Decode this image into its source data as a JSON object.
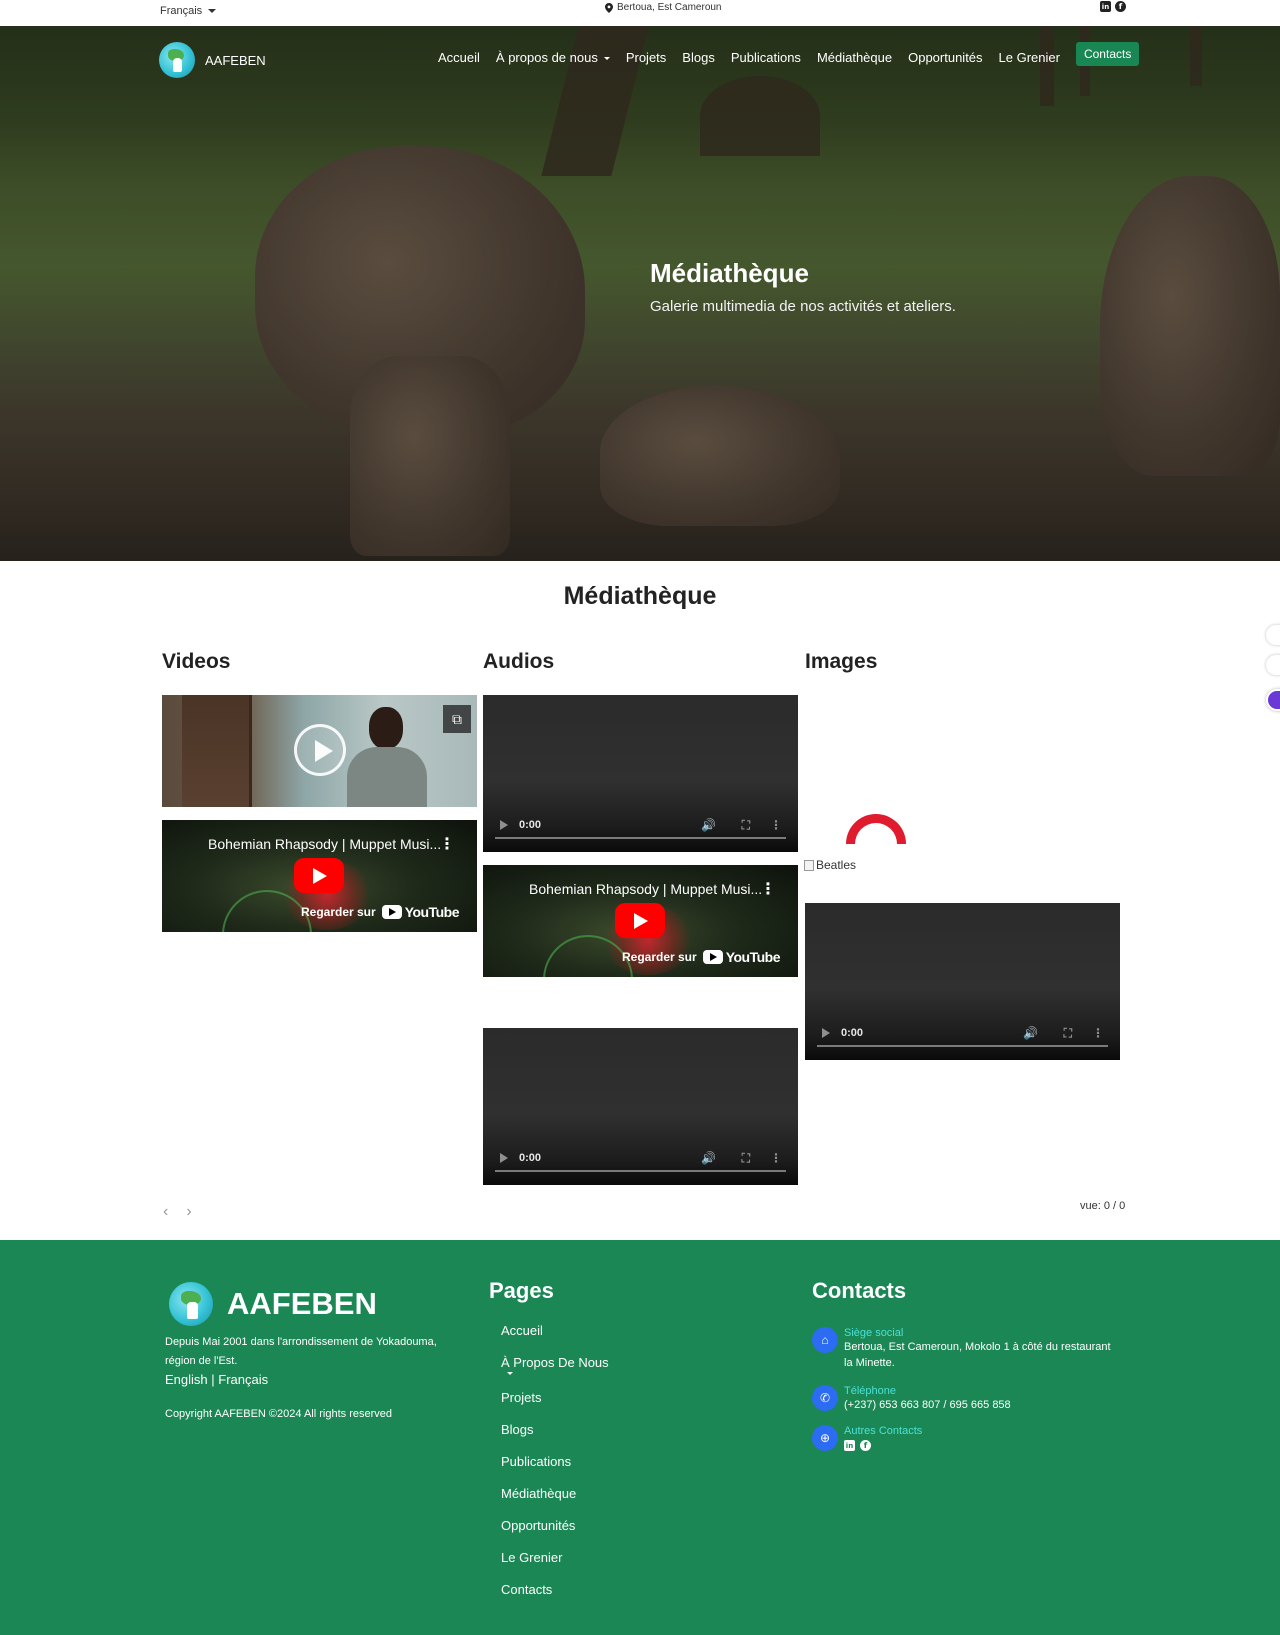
{
  "topbar": {
    "language": "Français",
    "location": "Bertoua, Est Cameroun",
    "social_icons": [
      "linkedin-icon",
      "facebook-icon"
    ]
  },
  "nav": {
    "brand": "AAFEBEN",
    "links": [
      "Accueil",
      "À propos de nous",
      "Projets",
      "Blogs",
      "Publications",
      "Médiathèque",
      "Opportunités",
      "Le Grenier"
    ],
    "contact_button": "Contacts"
  },
  "hero": {
    "title": "Médiathèque",
    "subtitle": "Galerie multimedia de nos activités et ateliers."
  },
  "media": {
    "title": "Médiathèque",
    "columns": {
      "videos": "Videos",
      "audios": "Audios",
      "images": "Images"
    },
    "youtube_card": {
      "title": "Bohemian Rhapsody | Muppet Musi...",
      "watch_label": "Regarder sur",
      "youtube_label": "YouTube"
    },
    "audio_time": "0:00",
    "broken_image_alt": "Beatles",
    "view_count": "vue: 0 / 0"
  },
  "footer": {
    "brand": "AAFEBEN",
    "description": "Depuis Mai 2001 dans l'arrondissement de Yokadouma, région de l'Est.",
    "lang_english": "English",
    "lang_sep": " | ",
    "lang_french": "Français",
    "copyright": "Copyright AAFEBEN ©2024 All rights reserved",
    "pages_title": "Pages",
    "pages": [
      "Accueil",
      "À Propos De Nous",
      "Projets",
      "Blogs",
      "Publications",
      "Médiathèque",
      "Opportunités",
      "Le Grenier",
      "Contacts"
    ],
    "contacts_title": "Contacts",
    "hq_label": "Siège social",
    "hq_text": "Bertoua, Est Cameroun, Mokolo 1 à côté du restaurant la Minette.",
    "phone_label": "Téléphone",
    "phone_text": "(+237) 653 663 807 / 695 665 858",
    "other_label": "Autres Contacts"
  },
  "colors": {
    "footer_bg": "#1a8754",
    "contact_button": "#198754",
    "contact_label": "#4de0d6",
    "contact_icon_bg": "#2b6cf3",
    "youtube_red": "#ff0000"
  }
}
